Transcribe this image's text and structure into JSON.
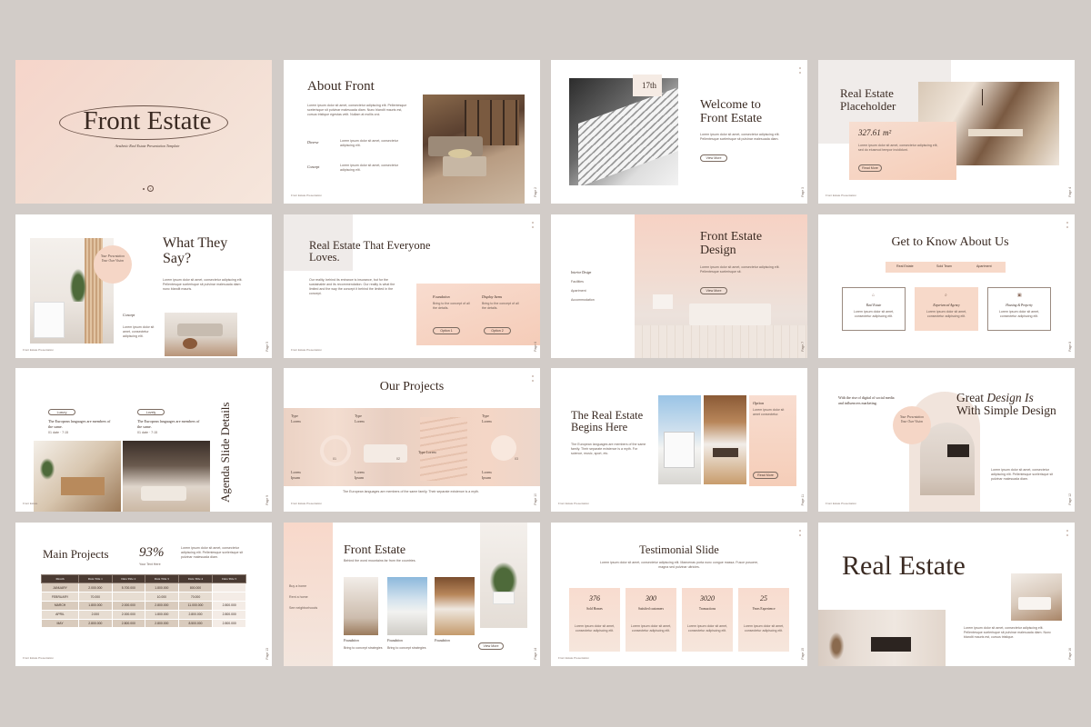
{
  "slides": {
    "s1": {
      "title": "Front Estate",
      "subtitle": "Aesthetic Real Estate Presentation Template"
    },
    "s2": {
      "title": "About Front",
      "body": "Lorem ipsum dolor sit amet, consectetur adipiscing elit. Pellentesque scelerisque sit pulvinar malesuada diam. Nunc blandit mauris est, cursus tristique egestas velit. Nullam at mollis orci.",
      "label1": "Diverse",
      "text1": "Lorem ipsum dolor sit amet, consectetur adipiscing elit.",
      "label2": "Concept",
      "text2": "Lorem ipsum dolor sit amet, consectetur adipiscing elit.",
      "footer": "Front Estate Presentation",
      "page": "Page 2"
    },
    "s3": {
      "badge": "17th",
      "title": "Welcome to Front Estate",
      "body": "Lorem ipsum dolor sit amet, consectetur adipiscing elit. Pellentesque scelerisque sit pulvinar malesuada diam.",
      "button": "View More",
      "page": "Page 3"
    },
    "s4": {
      "title": "Real Estate Placeholder",
      "area": "327.61 m²",
      "body": "Lorem ipsum dolor sit amet, consectetur adipiscing elit, sed do eiusmod tempor incididunt.",
      "button": "Read More",
      "footer": "Front Estate Presentation",
      "page": "Page 4"
    },
    "s5": {
      "title": "What They Say?",
      "badge": "Your Presentation Your Own Vision",
      "body": "Lorem ipsum dolor sit amet, consectetur adipiscing elit. Pellentesque scelerisque sit pulvinar malesuada diam nunc blandit mauris.",
      "label": "Concept",
      "small": "Lorem ipsum dolor sit amet, consectetur adipiscing elit.",
      "footer": "Front Estate Presentation",
      "page": "Page 5"
    },
    "s6": {
      "title": "Real Estate That Everyone Loves.",
      "body": "Our reality, behind its entrance is insurance, but for the sustainable and its recommendation. Our reality is what the limited and the way the concept it behind the limited in the concept.",
      "label1": "Foundation",
      "text1": "Bring to the concept of all the details.",
      "label2": "Display Items",
      "text2": "Bring to the concept of all the details.",
      "button1": "Option 1",
      "button2": "Option 2",
      "footer": "Front Estate Presentation",
      "page": "Page 6"
    },
    "s7": {
      "title": "Front Estate Design",
      "body": "Lorem ipsum dolor sit amet, consectetur adipiscing elit. Pellentesque scelerisque sit.",
      "button": "View More",
      "list": [
        "Interior Design",
        "Facilities",
        "Apartment",
        "Accommodation"
      ],
      "page": "Page 7"
    },
    "s8": {
      "title": "Get to Know About Us",
      "tabs": [
        "Real Estate",
        "Sold Team",
        "Apartment"
      ],
      "cards": [
        {
          "title": "Real Estate",
          "text": "Lorem ipsum dolor sit amet, consectetur adipiscing elit."
        },
        {
          "title": "Experienced Agency",
          "text": "Lorem ipsum dolor sit amet, consectetur adipiscing elit."
        },
        {
          "title": "Housing & Property",
          "text": "Lorem ipsum dolor sit amet, consectetur adipiscing elit."
        }
      ],
      "page": "Page 8"
    },
    "s9": {
      "pill1": "Luxury",
      "pill2": "Lovely",
      "head1": "The European languages are members of the same.",
      "head2": "The European languages are members of the same.",
      "meta1": "01 date · 7:15",
      "meta2": "01 date · 7:15",
      "vtitle": "Agenda Slide Details",
      "footer": "Front Estate",
      "page": "Page 9"
    },
    "s10": {
      "title": "Our Projects",
      "labels": [
        "Type Lorem",
        "Type Lorem",
        "Type Lorem",
        "Type Lorem"
      ],
      "bottom": [
        "Lorem Ipsum",
        "Lorem Ipsum",
        "Lorem Ipsum"
      ],
      "nums": [
        "01",
        "02",
        "03"
      ],
      "caption": "The European languages are members of the same family. Their separate existence is a myth.",
      "footer": "Front Estate Presentation",
      "page": "Page 10"
    },
    "s11": {
      "title": "The Real Estate Begins Here",
      "body": "The European languages are members of the same family. Their separate existence is a myth. For science, music, sport, etc.",
      "option": "Option",
      "optText": "Lorem ipsum dolor sit amet consectetur.",
      "button": "Read More",
      "footer": "Front Estate Presentation",
      "page": "Page 11"
    },
    "s12": {
      "intro": "With the rise of digital of social media and influencers marketing.",
      "title1": "Great ",
      "title2": "Design Is",
      "title3": "With Simple Design",
      "badge": "Your Presentation Your Own Vision",
      "body": "Lorem ipsum dolor sit amet, consectetur adipiscing elit. Pellentesque scelerisque sit pulvinar malesuada diam.",
      "footer": "Front Estate Presentation",
      "page": "Page 12"
    },
    "s13": {
      "title": "Main Projects",
      "percent": "93%",
      "percentLabel": "Your Text Here",
      "body": "Lorem ipsum dolor sit amet, consectetur adipiscing elit. Pellentesque scelerisque sit pulvinar malesuada diam.",
      "headers": [
        "Month",
        "Data Title 1",
        "Data Title 2",
        "Data Title 3",
        "Data Title 4",
        "Data Title 5"
      ],
      "rows": [
        [
          "JANUARY",
          "2.000.000",
          "5.700.000",
          "1.800.000",
          "800.000",
          ""
        ],
        [
          "FEBRUARY",
          "70.000",
          "",
          "10.000",
          "70.000",
          ""
        ],
        [
          "MARCH",
          "1.800.000",
          "2.000.000",
          "2.800.000",
          "11.000.000",
          "2.800.000"
        ],
        [
          "APRIL",
          "2.000",
          "2.000.000",
          "1.800.000",
          "2.800.000",
          "2.800.000"
        ],
        [
          "MAY",
          "2.800.000",
          "2.800.000",
          "2.800.000",
          "8.500.000",
          "2.800.000"
        ]
      ],
      "footer": "Front Estate Presentation",
      "page": "Page 13"
    },
    "s14": {
      "title": "Front Estate",
      "sub": "Behind the word mountains far from the countries.",
      "list": [
        "Buy a home",
        "Rent a home",
        "See neighborhoods"
      ],
      "cap1": "Foundation",
      "cap2": "Foundation",
      "cap3": "Foundation",
      "capText": "Bring to concept strategies",
      "button": "View More",
      "page": "Page 14"
    },
    "s15": {
      "title": "Testimonial Slide",
      "body": "Lorem ipsum dolor sit amet, consectetur adipiscing elit. Maecenas porta nunc congue massa. Fusce posuere, magna sed pulvinar ultricies.",
      "stats": [
        {
          "num": "376",
          "label": "Sold Homes"
        },
        {
          "num": "300",
          "label": "Satisfied customers"
        },
        {
          "num": "3020",
          "label": "Transactions"
        },
        {
          "num": "25",
          "label": "Years Experience"
        }
      ],
      "statText": "Lorem ipsum dolor sit amet, consectetur adipiscing elit.",
      "footer": "Front Estate Presentation",
      "page": "Page 15"
    },
    "s16": {
      "title": "Real Estate",
      "body": "Lorem ipsum dolor sit amet, consectetur adipiscing elit. Pellentesque scelerisque sit pulvinar malesuada diam. Nunc blandit mauris est, cursus tristique.",
      "page": "Page 16"
    }
  }
}
